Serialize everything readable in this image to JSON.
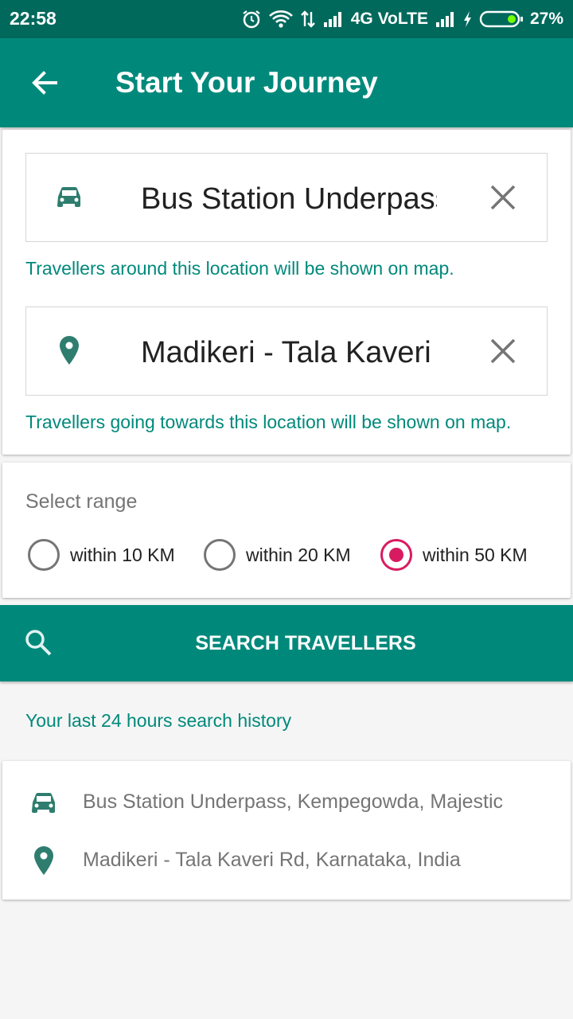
{
  "status_bar": {
    "time": "22:58",
    "network": "4G VoLTE",
    "battery": "27%",
    "icons": [
      "alarm-icon",
      "wifi-icon",
      "data-arrows-icon",
      "signal-icon",
      "signal-icon",
      "charging-icon",
      "battery-icon"
    ]
  },
  "app_bar": {
    "title": "Start Your Journey",
    "back_icon": "arrow-back-icon"
  },
  "locations": {
    "from": {
      "icon": "car-icon",
      "value": "Bus Station Underpass",
      "hint": "Travellers around this location will be shown on map.",
      "clear_icon": "close-icon"
    },
    "to": {
      "icon": "location-pin-icon",
      "value": "Madikeri - Tala Kaveri Rd",
      "hint": "Travellers going towards this location will be shown on map.",
      "clear_icon": "close-icon"
    }
  },
  "range": {
    "label": "Select range",
    "options": [
      {
        "label": "within 10 KM",
        "selected": false
      },
      {
        "label": "within 20 KM",
        "selected": false
      },
      {
        "label": "within 50 KM",
        "selected": true
      }
    ]
  },
  "search": {
    "label": "SEARCH TRAVELLERS",
    "icon": "search-icon"
  },
  "history": {
    "title": "Your last 24 hours search history",
    "items": [
      {
        "icon": "car-icon",
        "text": "Bus Station Underpass, Kempegowda, Majestic"
      },
      {
        "icon": "location-pin-icon",
        "text": "Madikeri - Tala Kaveri Rd, Karnataka, India"
      }
    ]
  },
  "colors": {
    "status_bar": "#00695c",
    "primary": "#00897b",
    "accent": "#d81b60",
    "icon_teal": "#2e7d6f"
  }
}
